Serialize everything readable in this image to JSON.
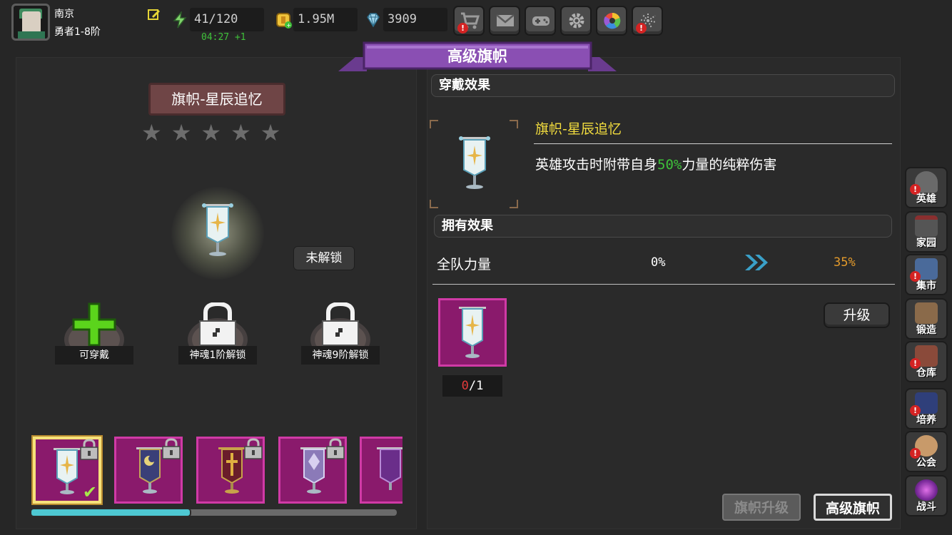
{
  "player": {
    "name": "南京",
    "rank": "勇者1-8阶"
  },
  "resources": {
    "stamina": "41/120",
    "stamina_timer": "04:27 +1",
    "gold": "1.95M",
    "gems": "3909"
  },
  "top_buttons": [
    "shop-cart-icon",
    "mail-envelope-icon",
    "gamepad-icon",
    "settings-gear-icon",
    "camera-aperture-icon",
    "firework-icon"
  ],
  "title": "高级旗帜",
  "banner": {
    "name": "旗帜-星辰追忆",
    "stars_total": 5,
    "stars_filled": 0,
    "lock_status": "未解锁"
  },
  "slots": [
    {
      "label": "可穿戴",
      "state": "available"
    },
    {
      "label": "神魂1阶解锁",
      "state": "locked"
    },
    {
      "label": "神魂9阶解锁",
      "state": "locked"
    }
  ],
  "wear_effect": {
    "heading": "穿戴效果",
    "item_name": "旗帜-星辰追忆",
    "desc_prefix": "英雄攻击时附带自身",
    "desc_pct": "50%",
    "desc_suffix": "力量的纯粹伤害"
  },
  "own_effect": {
    "heading": "拥有效果",
    "stat_name": "全队力量",
    "from": "0%",
    "to": "35%"
  },
  "material": {
    "have": "0",
    "sep": "/",
    "need": "1"
  },
  "upgrade_label": "升级",
  "tabs": {
    "inactive": "旗帜升级",
    "active": "高级旗帜"
  },
  "carousel": {
    "scroll_position": 0.44
  },
  "side_nav": [
    {
      "label": "英雄",
      "alert": true
    },
    {
      "label": "家园",
      "alert": false
    },
    {
      "label": "集市",
      "alert": true
    },
    {
      "label": "锻造",
      "alert": false
    },
    {
      "label": "仓库",
      "alert": true
    },
    {
      "label": "培养",
      "alert": true
    },
    {
      "label": "公会",
      "alert": true
    },
    {
      "label": "战斗",
      "alert": false
    }
  ],
  "colors": {
    "accent_purple": "#8a4fb3",
    "item_magenta": "#8a1a6c",
    "highlight_yellow": "#f2dc3e",
    "bonus_green": "#3ec23a",
    "bonus_orange": "#e39a2b"
  }
}
